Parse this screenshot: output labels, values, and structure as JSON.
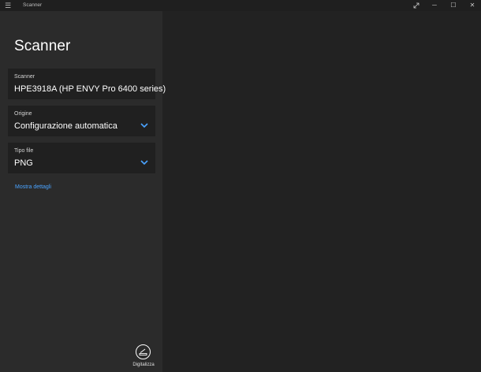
{
  "window": {
    "title": "Scanner",
    "controls": {
      "expand_icon": "expand-icon",
      "minimize": "─",
      "maximize": "☐",
      "close": "✕"
    }
  },
  "sidebar": {
    "title": "Scanner",
    "fields": [
      {
        "label": "Scanner",
        "value": "HPE3918A (HP ENVY Pro 6400 series)",
        "dropdown": false
      },
      {
        "label": "Origine",
        "value": "Configurazione automatica",
        "dropdown": true
      },
      {
        "label": "Tipo file",
        "value": "PNG",
        "dropdown": true
      }
    ],
    "details_link": "Mostra dettagli",
    "scan_button_label": "Digitalizza"
  },
  "colors": {
    "accent": "#4aa3ff",
    "sidebar_bg": "#2b2b2b",
    "preview_bg": "#222222",
    "card_bg": "#202020"
  }
}
